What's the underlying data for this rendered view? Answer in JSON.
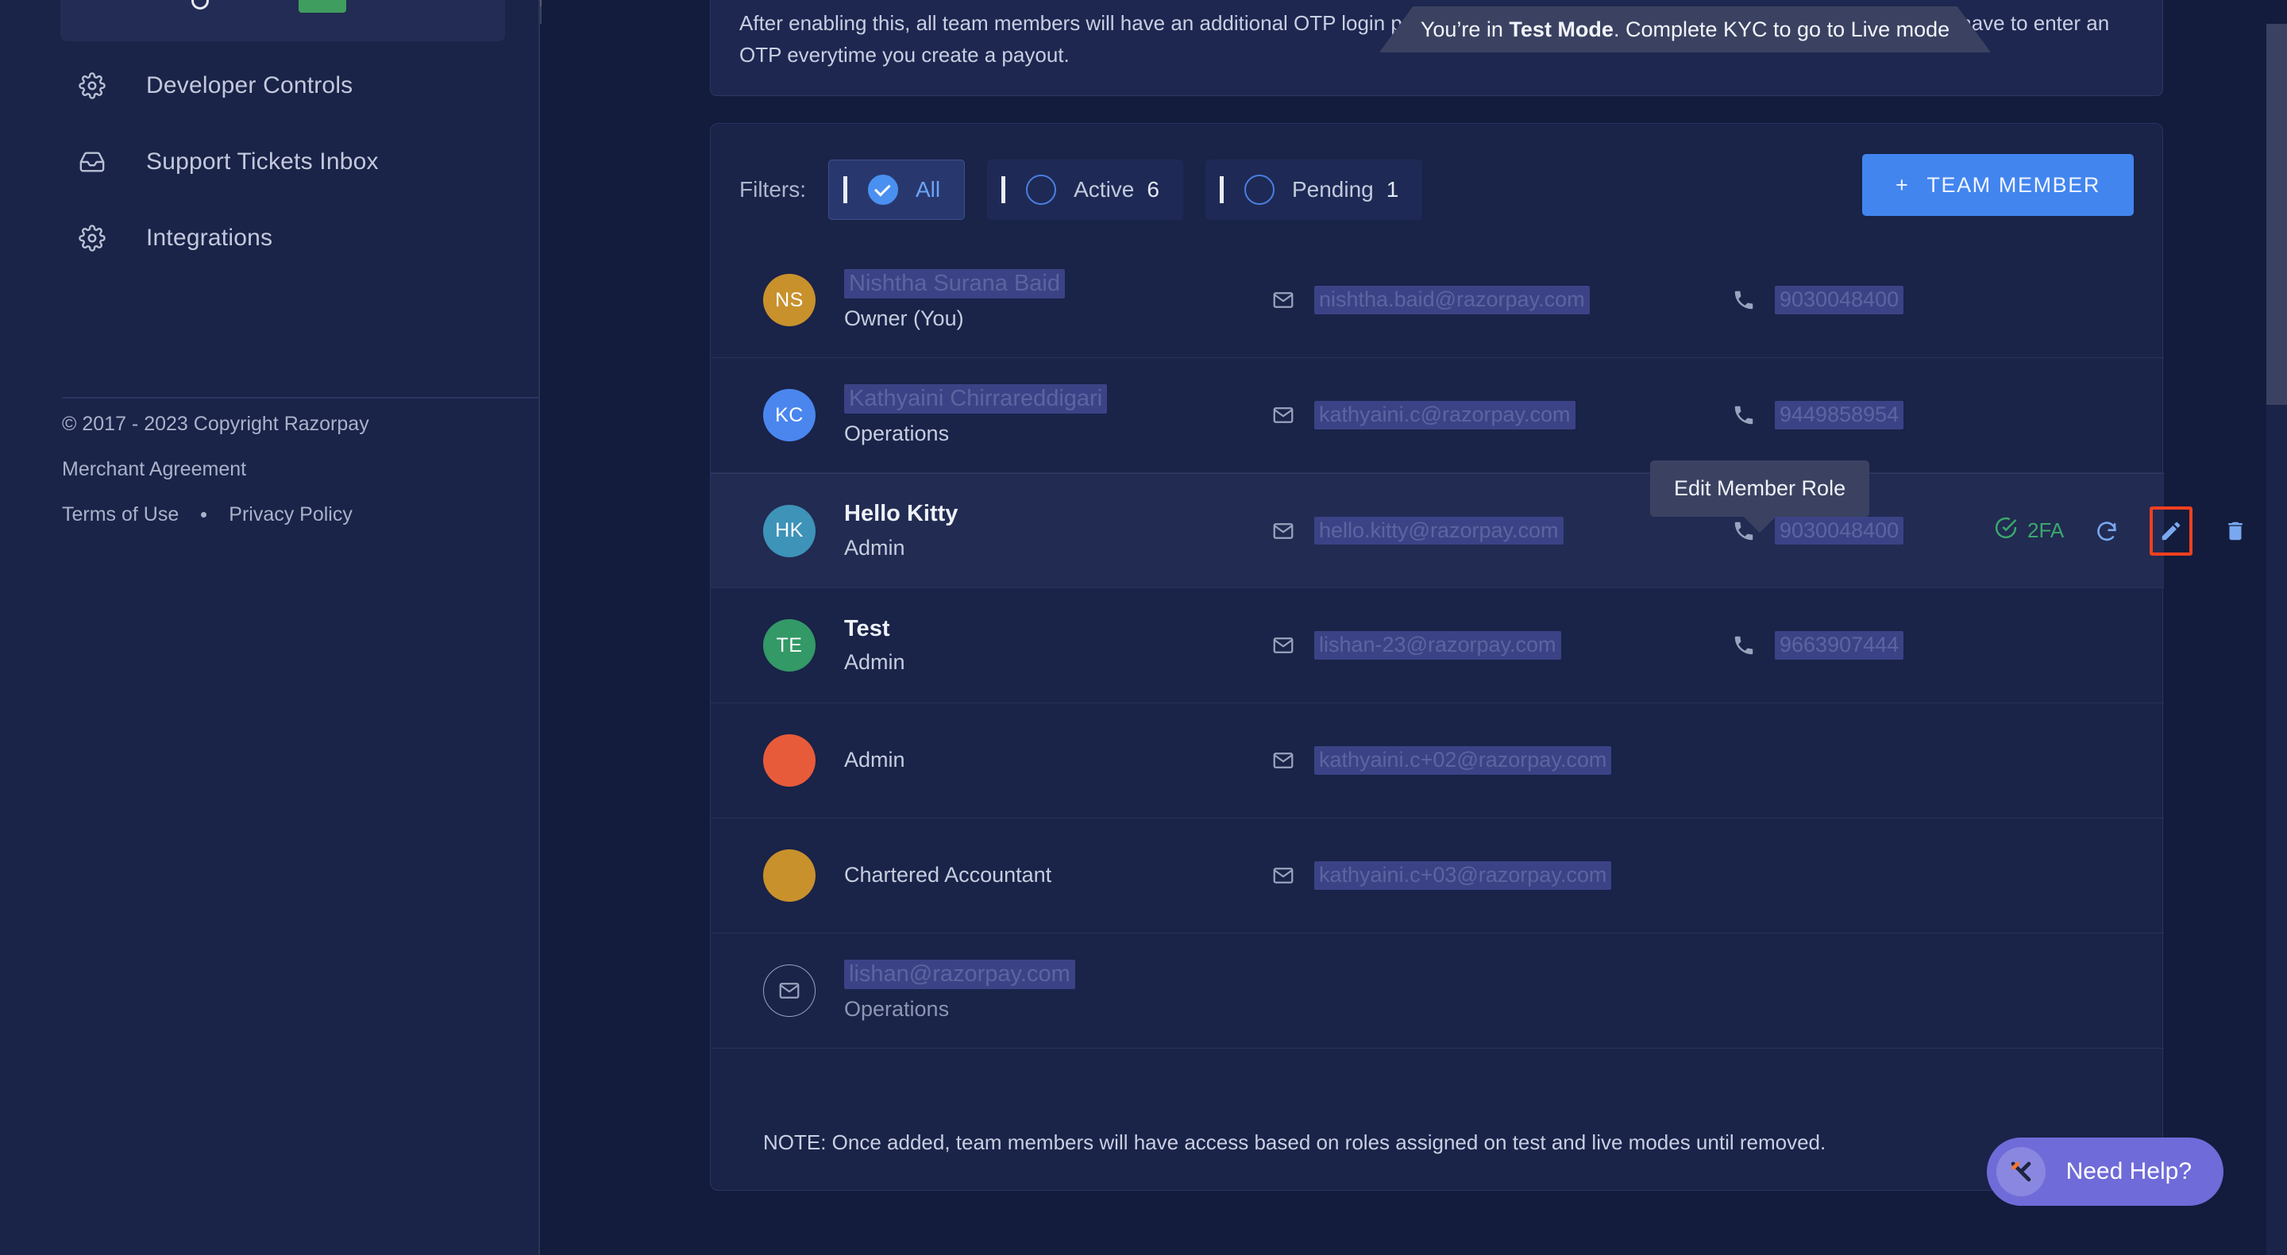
{
  "sidebar": {
    "nav_items": [
      {
        "label": "Developer Controls",
        "icon": "gear-icon"
      },
      {
        "label": "Support Tickets Inbox",
        "icon": "inbox-icon"
      },
      {
        "label": "Integrations",
        "icon": "gear-icon"
      }
    ],
    "footer": {
      "copyright": "© 2017 - 2023 Copyright Razorpay",
      "merchant_agreement": "Merchant Agreement",
      "terms_of_use": "Terms of Use",
      "privacy_policy": "Privacy Policy"
    }
  },
  "banner": {
    "text": "After enabling this, all team members will have an additional OTP login process everytime they login to the dashbaord. You would still have to enter an OTP everytime you create a payout."
  },
  "test_mode_tooltip": {
    "prefix": "You’re in ",
    "bold": "Test Mode",
    "suffix": ". Complete KYC to go to Live mode"
  },
  "filters": {
    "label": "Filters:",
    "options": [
      {
        "label": "All",
        "count": "",
        "selected": true
      },
      {
        "label": "Active",
        "count": "6",
        "selected": false
      },
      {
        "label": "Pending",
        "count": "1",
        "selected": false
      }
    ]
  },
  "add_member_button": {
    "plus": "+",
    "label": "TEAM MEMBER"
  },
  "members": [
    {
      "initials": "NS",
      "avatar_color": "#c8912c",
      "name": "Nishtha Surana Baid",
      "name_redacted": true,
      "role": "Owner (You)",
      "email": "nishtha.baid@razorpay.com",
      "email_redacted": true,
      "phone": "9030048400",
      "phone_redacted": true,
      "has_2fa": false,
      "has_actions": false,
      "highlighted": false,
      "pending": false
    },
    {
      "initials": "KC",
      "avatar_color": "#4a86ee",
      "name": "Kathyaini Chirrareddigari",
      "name_redacted": true,
      "role": "Operations",
      "email": "kathyaini.c@razorpay.com",
      "email_redacted": true,
      "phone": "9449858954",
      "phone_redacted": true,
      "has_2fa": false,
      "has_actions": false,
      "highlighted": false,
      "pending": false
    },
    {
      "initials": "HK",
      "avatar_color": "#3e93b8",
      "name": "Hello Kitty",
      "name_redacted": false,
      "role": "Admin",
      "email": "hello.kitty@razorpay.com",
      "email_redacted": true,
      "phone": "9030048400",
      "phone_redacted": true,
      "has_2fa": true,
      "twofa_label": "2FA",
      "has_actions": true,
      "highlighted": true,
      "pending": false
    },
    {
      "initials": "TE",
      "avatar_color": "#339966",
      "name": "Test",
      "name_redacted": false,
      "role": "Admin",
      "email": "lishan-23@razorpay.com",
      "email_redacted": true,
      "phone": "9663907444",
      "phone_redacted": true,
      "has_2fa": false,
      "has_actions": false,
      "highlighted": false,
      "pending": false
    },
    {
      "initials": "",
      "avatar_color": "#e85b3a",
      "name": "",
      "name_redacted": false,
      "role": "Admin",
      "email": "kathyaini.c+02@razorpay.com",
      "email_redacted": true,
      "phone": "",
      "phone_redacted": false,
      "has_2fa": false,
      "has_actions": false,
      "highlighted": false,
      "pending": false
    },
    {
      "initials": "",
      "avatar_color": "#c8912c",
      "name": "",
      "name_redacted": false,
      "role": "Chartered Accountant",
      "email": "kathyaini.c+03@razorpay.com",
      "email_redacted": true,
      "phone": "",
      "phone_redacted": false,
      "has_2fa": false,
      "has_actions": false,
      "highlighted": false,
      "pending": false
    },
    {
      "initials": "",
      "avatar_color": "",
      "name": "lishan@razorpay.com",
      "name_redacted": true,
      "role": "Operations",
      "email": "",
      "email_redacted": false,
      "phone": "",
      "phone_redacted": false,
      "has_2fa": false,
      "has_actions": false,
      "highlighted": false,
      "pending": true
    }
  ],
  "edit_tooltip": {
    "text": "Edit Member Role"
  },
  "note": {
    "text": "NOTE: Once added, team members will have access based on roles assigned on test and live modes until removed."
  },
  "need_help": {
    "label": "Need Help?"
  },
  "colors": {
    "accent_blue": "#4285ef",
    "success_green": "#3aa86b",
    "highlight_red": "#f0401f",
    "need_help_purple": "#6f6bd8"
  }
}
